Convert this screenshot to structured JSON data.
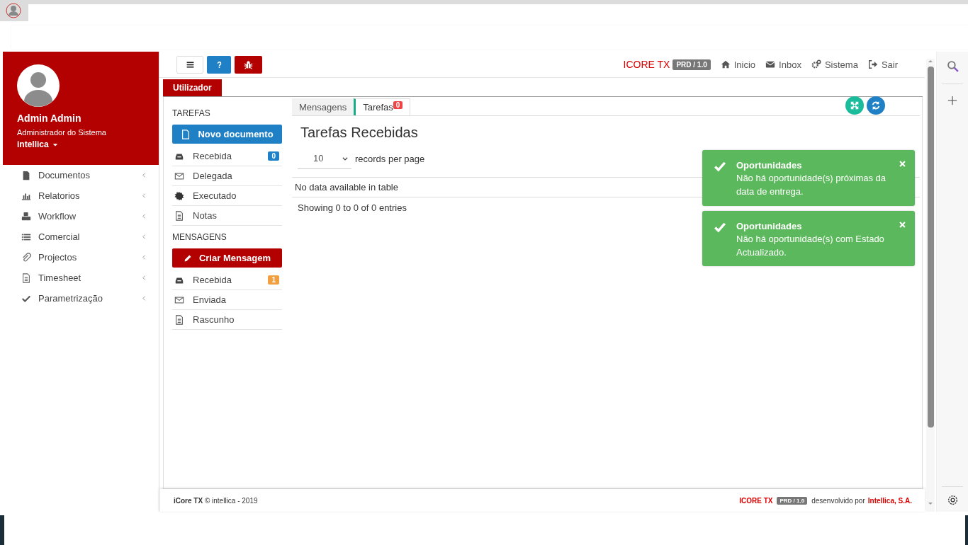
{
  "user": {
    "name": "Admin Admin",
    "role": "Administrador do Sistema",
    "company": "intellica"
  },
  "sidebar": {
    "items": [
      {
        "label": "Documentos"
      },
      {
        "label": "Relatorios"
      },
      {
        "label": "Workflow"
      },
      {
        "label": "Comercial"
      },
      {
        "label": "Projectos"
      },
      {
        "label": "Timesheet"
      },
      {
        "label": "Parametrização"
      }
    ]
  },
  "header_nav": {
    "brand": "ICORE TX",
    "version": "PRD / 1.0",
    "links": [
      "Inicio",
      "Inbox",
      "Sistema",
      "Sair"
    ]
  },
  "page_tab": "Utilizador",
  "tasks": {
    "heading": "TAREFAS",
    "button": "Novo documento",
    "items": [
      {
        "label": "Recebida",
        "badge": "0"
      },
      {
        "label": "Delegada"
      },
      {
        "label": "Executado"
      },
      {
        "label": "Notas"
      }
    ]
  },
  "messages": {
    "heading": "MENSAGENS",
    "button": "Criar Mensagem",
    "items": [
      {
        "label": "Recebida",
        "badge": "1"
      },
      {
        "label": "Enviada"
      },
      {
        "label": "Rascunho"
      }
    ]
  },
  "tabs": [
    {
      "label": "Mensagens",
      "selected": false
    },
    {
      "label": "Tarefas",
      "badge": "0",
      "selected": true
    }
  ],
  "content": {
    "title": "Tarefas Recebidas",
    "page_size": "10",
    "page_size_label": "records per page",
    "empty": "No data available in table",
    "info": "Showing 0 to 0 of 0 entries"
  },
  "toasts": [
    {
      "title": "Oportunidades",
      "message": "Não há oportunidade(s) próximas da data de entrega."
    },
    {
      "title": "Oportunidades",
      "message": "Não há oportunidade(s) com Estado Actualizado."
    }
  ],
  "footer": {
    "left": "**iCore TX** © intellica - 2019",
    "brand": "ICORE TX",
    "version": "PRD / 1.0",
    "credit": "desenvolvido por",
    "company": "Intellica, S.A."
  }
}
